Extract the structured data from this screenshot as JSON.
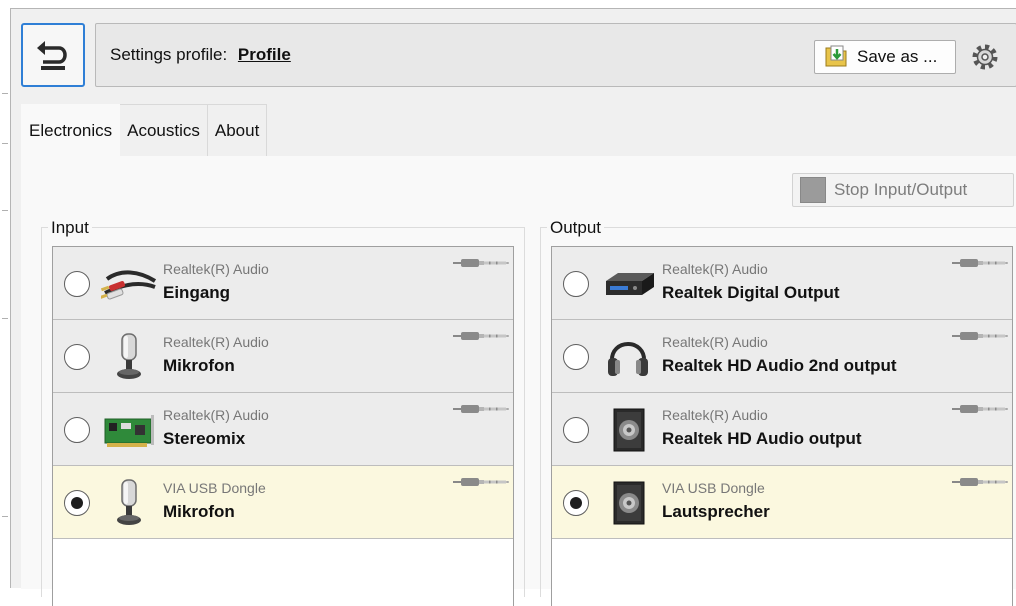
{
  "header": {
    "profile_label": "Settings profile:",
    "profile_name": "Profile",
    "save_label": "Save as ..."
  },
  "tabs": [
    {
      "label": "Electronics",
      "active": true
    },
    {
      "label": "Acoustics",
      "active": false
    },
    {
      "label": "About",
      "active": false
    }
  ],
  "stop_button": {
    "label": "Stop Input/Output",
    "enabled": false
  },
  "input": {
    "title": "Input",
    "devices": [
      {
        "driver": "Realtek(R) Audio",
        "name": "Eingang",
        "icon": "rca-cable-icon",
        "selected": false
      },
      {
        "driver": "Realtek(R) Audio",
        "name": "Mikrofon",
        "icon": "microphone-icon",
        "selected": false
      },
      {
        "driver": "Realtek(R) Audio",
        "name": "Stereomix",
        "icon": "sound-card-icon",
        "selected": false
      },
      {
        "driver": "VIA USB Dongle",
        "name": "Mikrofon",
        "icon": "microphone-icon",
        "selected": true
      }
    ]
  },
  "output": {
    "title": "Output",
    "devices": [
      {
        "driver": "Realtek(R) Audio",
        "name": "Realtek Digital Output",
        "icon": "digital-output-box-icon",
        "selected": false
      },
      {
        "driver": "Realtek(R) Audio",
        "name": "Realtek HD Audio 2nd output",
        "icon": "headphones-icon",
        "selected": false
      },
      {
        "driver": "Realtek(R) Audio",
        "name": "Realtek HD Audio output",
        "icon": "speaker-icon",
        "selected": false
      },
      {
        "driver": "VIA USB Dongle",
        "name": "Lautsprecher",
        "icon": "speaker-icon",
        "selected": true
      }
    ]
  },
  "colors": {
    "selected_row": "#fbf8df",
    "row": "#ececec",
    "accent_border": "#2f7fd6"
  }
}
